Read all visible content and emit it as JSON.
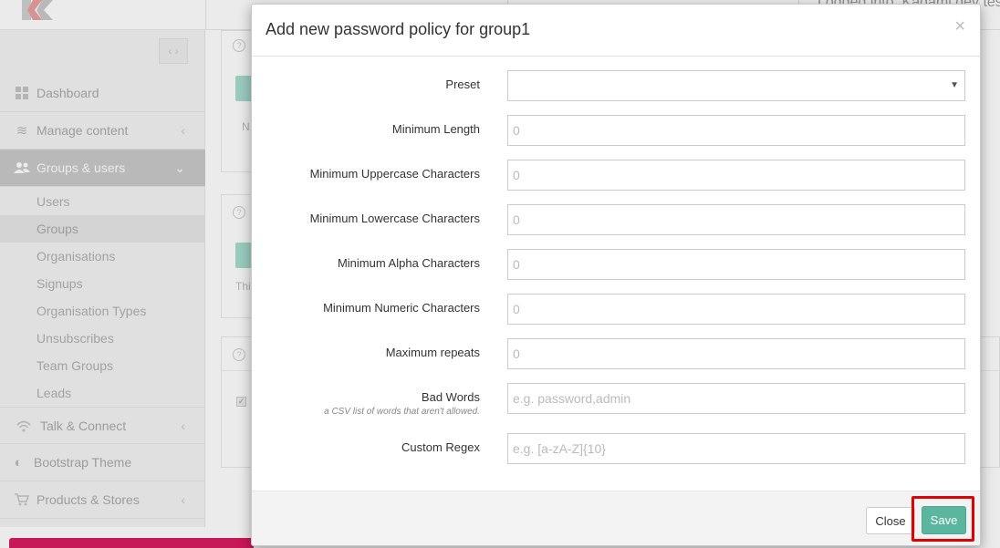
{
  "header": {
    "login_text": "Logged into: Kadami dev tes"
  },
  "sidebar": {
    "collapse_label": "‹ ›",
    "items": [
      {
        "label": "Dashboard",
        "icon": "grid-icon"
      },
      {
        "label": "Manage content",
        "icon": "layers-icon"
      },
      {
        "label": "Groups & users",
        "icon": "users-icon"
      },
      {
        "label": "Talk & Connect",
        "icon": "wifi-icon"
      },
      {
        "label": "Bootstrap Theme",
        "icon": "contrast-icon"
      },
      {
        "label": "Products & Stores",
        "icon": "cart-icon"
      }
    ],
    "sub_items": [
      {
        "label": "Users"
      },
      {
        "label": "Groups"
      },
      {
        "label": "Organisations"
      },
      {
        "label": "Signups"
      },
      {
        "label": "Organisation Types"
      },
      {
        "label": "Unsubscribes"
      },
      {
        "label": "Team Groups"
      },
      {
        "label": "Leads"
      }
    ]
  },
  "background": {
    "card1_text": "N",
    "card2_text": "Thi"
  },
  "modal": {
    "title": "Add new password policy for group1",
    "close_symbol": "×",
    "fields": {
      "preset": {
        "label": "Preset",
        "value": ""
      },
      "min_length": {
        "label": "Minimum Length",
        "placeholder": "0"
      },
      "min_upper": {
        "label": "Minimum Uppercase Characters",
        "placeholder": "0"
      },
      "min_lower": {
        "label": "Minimum Lowercase Characters",
        "placeholder": "0"
      },
      "min_alpha": {
        "label": "Minimum Alpha Characters",
        "placeholder": "0"
      },
      "min_numeric": {
        "label": "Minimum Numeric Characters",
        "placeholder": "0"
      },
      "max_repeats": {
        "label": "Maximum repeats",
        "placeholder": "0"
      },
      "bad_words": {
        "label": "Bad Words",
        "hint": "a CSV list of words that aren't allowed.",
        "placeholder": "e.g. password,admin"
      },
      "custom_regex": {
        "label": "Custom Regex",
        "placeholder": "e.g. [a-zA-Z]{10}"
      }
    },
    "footer": {
      "close_label": "Close",
      "save_label": "Save"
    }
  },
  "colors": {
    "save_button": "#5bb69f",
    "highlight": "#e00000",
    "promo_bar": "#d81b60"
  }
}
